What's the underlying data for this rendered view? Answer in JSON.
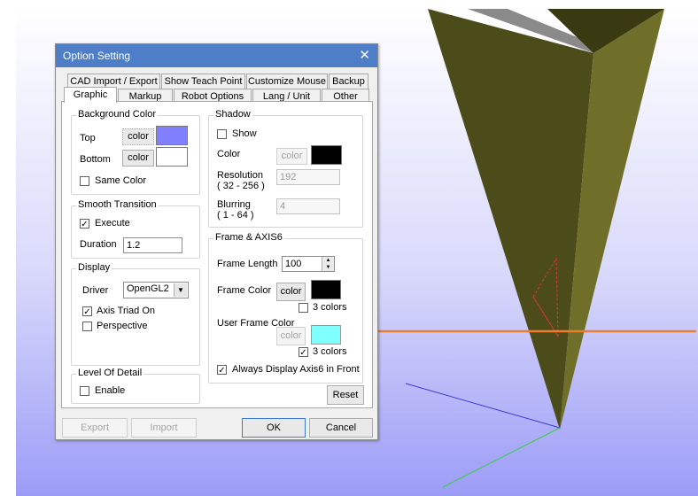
{
  "dialog": {
    "title": "Option Setting",
    "close_glyph": "✕",
    "tabs_row1": [
      "CAD Import / Export",
      "Show Teach Point",
      "Customize Mouse",
      "Backup"
    ],
    "tabs_row2": [
      "Graphic",
      "Markup",
      "Robot Options",
      "Lang / Unit",
      "Other"
    ],
    "active_tab": "Graphic"
  },
  "background_color": {
    "title": "Background Color",
    "top_label": "Top",
    "bottom_label": "Bottom",
    "color_button": "color",
    "top_color": "#8080ff",
    "bottom_color": "#ffffff",
    "same_color_label": "Same Color",
    "same_color_checked": false
  },
  "smooth_transition": {
    "title": "Smooth Transition",
    "execute_label": "Execute",
    "execute_checked": true,
    "duration_label": "Duration",
    "duration_value": "1.2"
  },
  "display": {
    "title": "Display",
    "driver_label": "Driver",
    "driver_value": "OpenGL2",
    "axis_triad_label": "Axis Triad On",
    "axis_triad_checked": true,
    "perspective_label": "Perspective",
    "perspective_checked": false
  },
  "level_of_detail": {
    "title": "Level Of Detail",
    "enable_label": "Enable",
    "enable_checked": false
  },
  "shadow": {
    "title": "Shadow",
    "show_label": "Show",
    "show_checked": false,
    "color_label": "Color",
    "color_button": "color",
    "color_value": "#000000",
    "resolution_label": "Resolution",
    "resolution_range": "( 32 - 256 )",
    "resolution_value": "192",
    "blurring_label": "Blurring",
    "blurring_range": "( 1 - 64 )",
    "blurring_value": "4"
  },
  "frame_axis6": {
    "title": "Frame & AXIS6",
    "frame_length_label": "Frame Length",
    "frame_length_value": "100",
    "frame_color_label": "Frame Color",
    "color_button": "color",
    "frame_color_value": "#000000",
    "three_colors_label": "3 colors",
    "frame_three_colors_checked": false,
    "user_frame_color_label": "User Frame Color",
    "user_frame_color_value": "#80ffff",
    "user_three_colors_checked": true,
    "always_display_label": "Always Display Axis6 in Front",
    "always_display_checked": true
  },
  "buttons": {
    "reset": "Reset",
    "export": "Export",
    "import": "Import",
    "ok": "OK",
    "cancel": "Cancel"
  },
  "colors": {
    "highlight": "#ed7d31",
    "cone": "#5a5a1f",
    "titlebar": "#4f7ec9"
  }
}
